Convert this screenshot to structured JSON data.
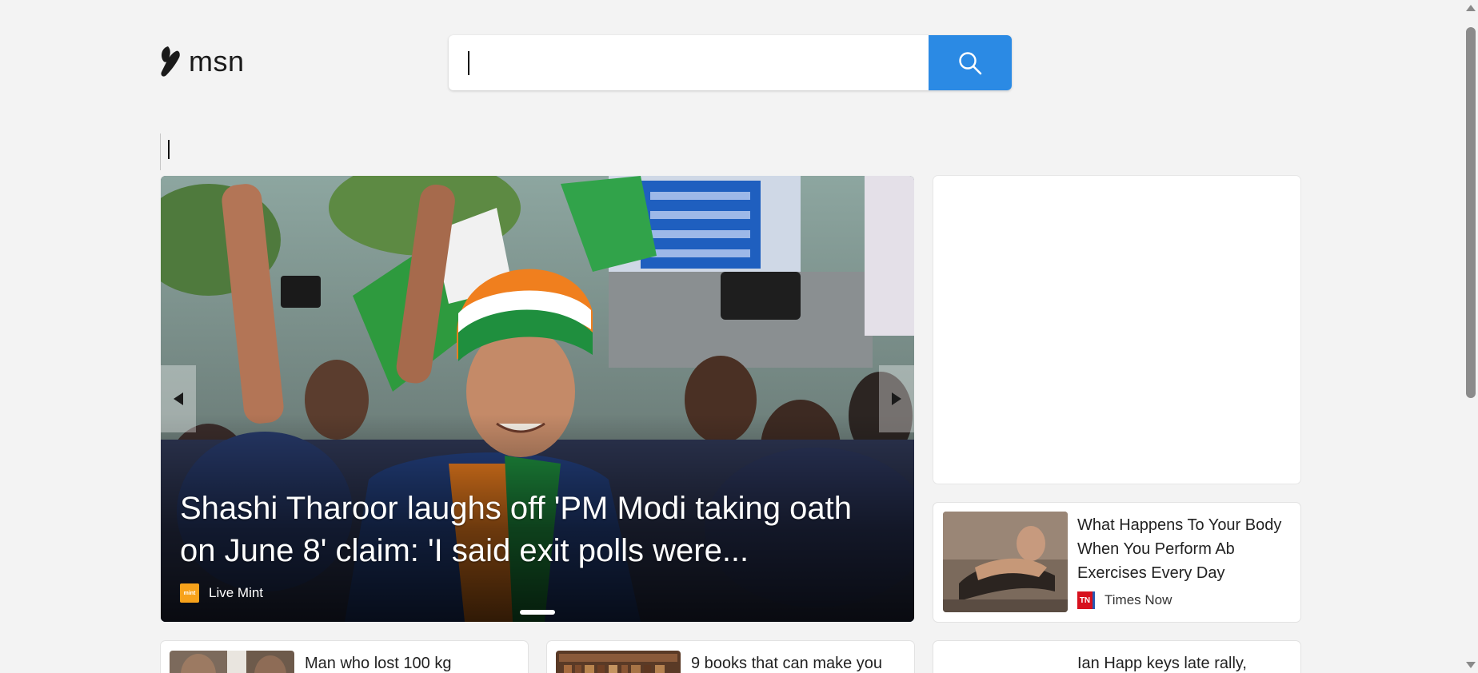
{
  "header": {
    "logo_text": "msn",
    "logo_icon": "msn-butterfly-icon",
    "search": {
      "placeholder": "",
      "value": "",
      "button_icon": "search-icon",
      "button_color": "#2b8ae4"
    }
  },
  "hero": {
    "title": "Shashi Tharoor laughs off 'PM Modi taking oath on June 8' claim: 'I said exit polls were...",
    "source": "Live Mint",
    "source_logo_text": "mint",
    "source_logo_color": "#f7a21b",
    "prev_icon": "chevron-left-icon",
    "next_icon": "chevron-right-icon",
    "active_slide": 1
  },
  "side_card": {
    "title": "What Happens To Your Body When You Perform Ab Exercises Every Day",
    "source": "Times Now",
    "source_logo_text": "TN"
  },
  "bottom_cards": [
    {
      "title": "Man who lost 100 kg"
    },
    {
      "title": "9 books that can make you"
    },
    {
      "title": "Ian Happ keys late rally,"
    }
  ]
}
